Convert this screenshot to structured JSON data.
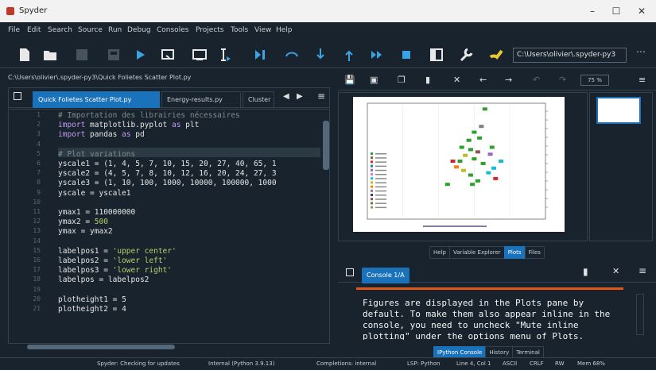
{
  "window": {
    "title": "Spyder",
    "controls": [
      "–",
      "☐",
      "✕"
    ]
  },
  "menu": [
    "File",
    "Edit",
    "Search",
    "Source",
    "Run",
    "Debug",
    "Consoles",
    "Projects",
    "Tools",
    "View",
    "Help"
  ],
  "toolbar": {
    "icons": [
      "new-file-icon",
      "open-folder-icon",
      "save-icon",
      "save-all-icon",
      "run-icon",
      "run-cell-icon",
      "run-cell-advance-icon",
      "run-selection-icon",
      "debug-icon",
      "step-icon",
      "step-into-icon",
      "step-return-icon",
      "continue-icon",
      "stop-icon",
      "maximize-pane-icon",
      "preferences-icon",
      "python-path-icon"
    ],
    "working_dir": "C:\\Users\\olivier\\.spyder-py3"
  },
  "editor": {
    "path": "C:\\Users\\olivier\\.spyder-py3\\Quick Folietes Scatter Plot.py",
    "tabs": [
      {
        "label": "Quick Folietes Scatter Plot.py",
        "active": true
      },
      {
        "label": "Energy-results.py",
        "active": false
      },
      {
        "label": "Cluster",
        "active": false
      }
    ],
    "lines": [
      {
        "n": "1",
        "parts": [
          {
            "t": "# Importation des librairies nécessaires",
            "c": "cm"
          }
        ]
      },
      {
        "n": "2",
        "parts": [
          {
            "t": "import ",
            "c": "kw"
          },
          {
            "t": "matplotlib.pyplot ",
            "c": ""
          },
          {
            "t": "as ",
            "c": "kw"
          },
          {
            "t": "plt",
            "c": ""
          }
        ]
      },
      {
        "n": "3",
        "parts": [
          {
            "t": "import ",
            "c": "kw"
          },
          {
            "t": "pandas ",
            "c": ""
          },
          {
            "t": "as ",
            "c": "kw"
          },
          {
            "t": "pd",
            "c": ""
          }
        ]
      },
      {
        "n": "4",
        "parts": []
      },
      {
        "n": "5",
        "parts": [
          {
            "t": "# Plot variations",
            "c": "cm"
          }
        ]
      },
      {
        "n": "6",
        "parts": [
          {
            "t": "yscale1 = (1, 4, 5, 7, 10, 15, 20, 27, 40, 65, 1",
            "c": ""
          }
        ]
      },
      {
        "n": "7",
        "parts": [
          {
            "t": "yscale2 = (4, 5, 7, 8, 10, 12, 16, 20, 24, 27, 3",
            "c": ""
          }
        ]
      },
      {
        "n": "8",
        "parts": [
          {
            "t": "yscale3 = (1, 10, 100, 1000, 10000, 100000, 1000",
            "c": ""
          }
        ]
      },
      {
        "n": "9",
        "parts": [
          {
            "t": "yscale = yscale1",
            "c": ""
          }
        ]
      },
      {
        "n": "10",
        "parts": []
      },
      {
        "n": "11",
        "parts": [
          {
            "t": "ymax1 = 110000000",
            "c": ""
          }
        ]
      },
      {
        "n": "12",
        "parts": [
          {
            "t": "ymax2 = ",
            "c": ""
          },
          {
            "t": "500",
            "c": "str"
          }
        ]
      },
      {
        "n": "13",
        "parts": [
          {
            "t": "ymax = ymax2",
            "c": ""
          }
        ]
      },
      {
        "n": "14",
        "parts": []
      },
      {
        "n": "15",
        "parts": [
          {
            "t": "labelpos1 = ",
            "c": ""
          },
          {
            "t": "'upper center'",
            "c": "str"
          }
        ]
      },
      {
        "n": "16",
        "parts": [
          {
            "t": "labelpos2 = ",
            "c": ""
          },
          {
            "t": "'lower left'",
            "c": "str"
          }
        ]
      },
      {
        "n": "17",
        "parts": [
          {
            "t": "labelpos3 = ",
            "c": ""
          },
          {
            "t": "'lower right'",
            "c": "str"
          }
        ]
      },
      {
        "n": "18",
        "parts": [
          {
            "t": "labelpos = labelpos2",
            "c": ""
          }
        ]
      },
      {
        "n": "19",
        "parts": []
      },
      {
        "n": "20",
        "parts": [
          {
            "t": "plotheight1 = 5",
            "c": ""
          }
        ]
      },
      {
        "n": "21",
        "parts": [
          {
            "t": "plotheight2 = 4",
            "c": ""
          }
        ]
      }
    ]
  },
  "plots": {
    "toolbar_icons": [
      "save-plot-icon",
      "save-all-plots-icon",
      "copy-icon",
      "delete-icon",
      "close-all-icon",
      "previous-icon",
      "next-icon",
      "zoom-out-icon",
      "zoom-in-icon"
    ],
    "zoom": "75 %",
    "tabs": [
      {
        "label": "Help",
        "active": false
      },
      {
        "label": "Variable Explorer",
        "active": false
      },
      {
        "label": "Plots",
        "active": true
      },
      {
        "label": "Files",
        "active": false
      }
    ]
  },
  "chart_data": {
    "type": "scatter",
    "title": "",
    "legend_position": "left",
    "colors": [
      "#2ca02c",
      "#8c564b",
      "#d62728",
      "#1f77b4",
      "#9467bd",
      "#e377c2",
      "#17becf",
      "#bcbd22",
      "#ff7f0e",
      "#7f7f7f",
      "#393b79",
      "#ad494a",
      "#637939",
      "#8ca252",
      "#6b6ecf",
      "#843c39"
    ],
    "x": [
      0.45,
      0.5,
      0.52,
      0.55,
      0.58,
      0.6,
      0.62,
      0.63,
      0.65,
      0.68,
      0.7,
      0.72,
      0.58,
      0.54,
      0.66,
      0.6,
      0.75,
      0.48,
      0.62,
      0.69,
      0.53,
      0.57,
      0.71,
      0.64,
      0.59
    ],
    "y": [
      0.3,
      0.45,
      0.5,
      0.55,
      0.6,
      0.52,
      0.58,
      0.7,
      0.48,
      0.4,
      0.62,
      0.35,
      0.38,
      0.42,
      0.95,
      0.75,
      0.5,
      0.5,
      0.33,
      0.56,
      0.62,
      0.68,
      0.44,
      0.8,
      0.3
    ],
    "point_colors": [
      0,
      8,
      0,
      7,
      0,
      0,
      1,
      0,
      0,
      6,
      0,
      2,
      0,
      7,
      0,
      0,
      6,
      2,
      0,
      4,
      0,
      0,
      6,
      9,
      0
    ]
  },
  "console": {
    "tab_label": "Console 1/A",
    "icons": [
      "document-icon",
      "close-icon",
      "menu-icon"
    ],
    "output": [
      "Figures are displayed in the Plots pane by",
      "default. To make them also appear inline in the",
      "console, you need to uncheck \"Mute inline",
      "plotting\" under the options menu of Plots."
    ],
    "tabs": [
      {
        "label": "IPython Console",
        "active": true
      },
      {
        "label": "History",
        "active": false
      },
      {
        "label": "Terminal",
        "active": false
      }
    ]
  },
  "status": {
    "items": [
      "Spyder: Checking for updates",
      "Internal (Python 3.9.13)",
      "Completions: internal",
      "LSP: Python",
      "Line 4, Col 1",
      "ASCII",
      "CRLF",
      "RW",
      "Mem 68%"
    ]
  }
}
